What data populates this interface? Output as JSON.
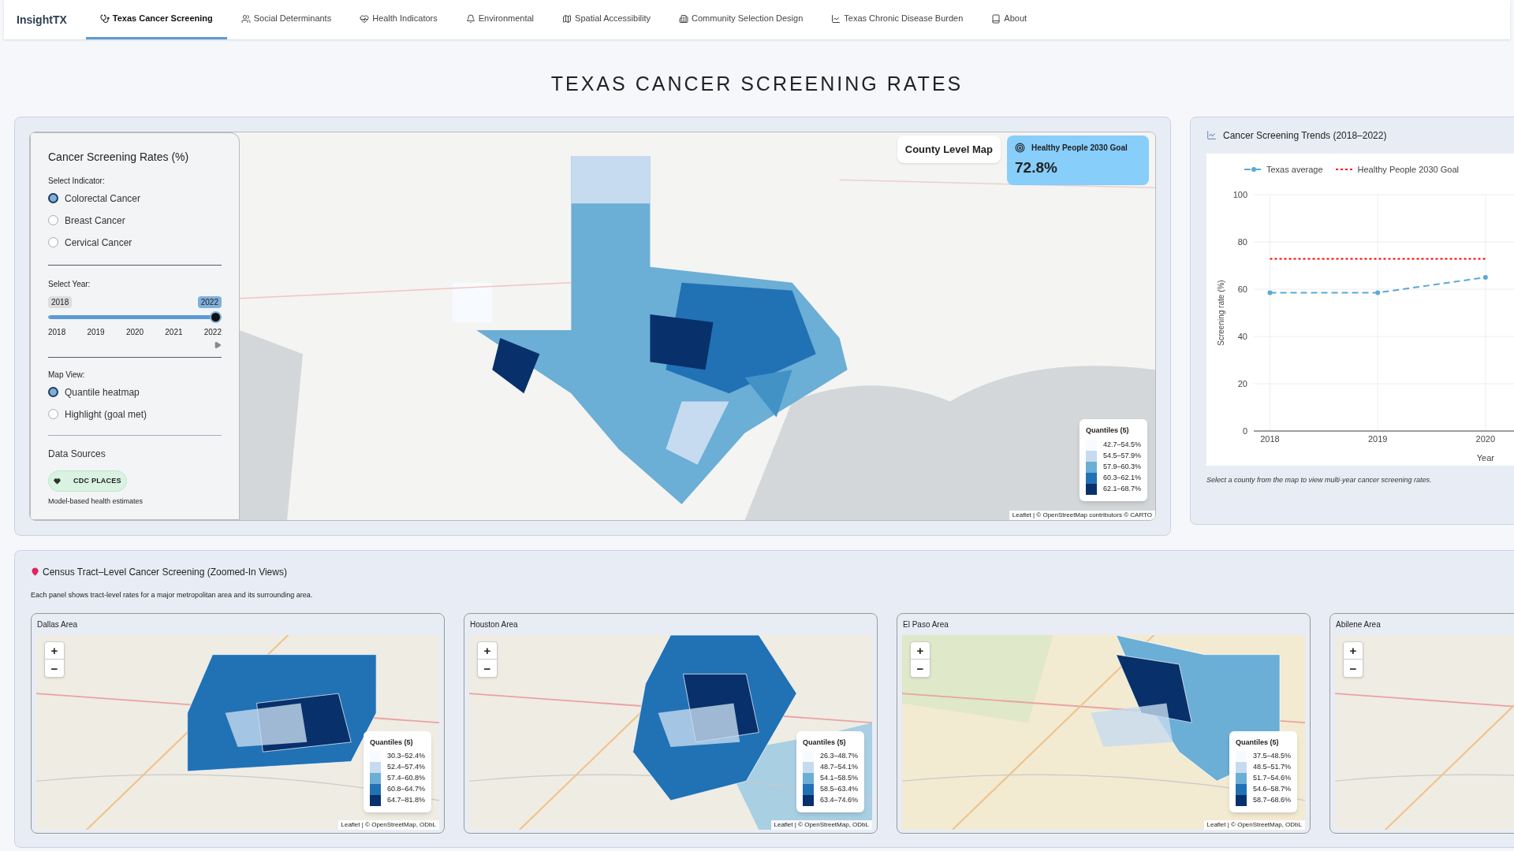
{
  "nav": {
    "brand": "InsightTX",
    "tabs": [
      {
        "label": "Texas Cancer Screening",
        "selected": true
      },
      {
        "label": "Social Determinants",
        "selected": false
      },
      {
        "label": "Health Indicators",
        "selected": false
      },
      {
        "label": "Environmental",
        "selected": false
      },
      {
        "label": "Spatial Accessibility",
        "selected": false
      },
      {
        "label": "Community Selection Design",
        "selected": false
      },
      {
        "label": "Texas Chronic Disease Burden",
        "selected": false
      },
      {
        "label": "About",
        "selected": false
      }
    ]
  },
  "page_title": "TEXAS CANCER SCREENING RATES",
  "controls": {
    "title": "Cancer Screening Rates (%)",
    "indicator_label": "Select Indicator:",
    "indicators": [
      {
        "label": "Colorectal Cancer",
        "selected": true
      },
      {
        "label": "Breast Cancer",
        "selected": false
      },
      {
        "label": "Cervical Cancer",
        "selected": false
      }
    ],
    "year_label": "Select Year:",
    "year_slider": {
      "min_label": "2018",
      "value_label": "2022",
      "level": 1,
      "ticks": [
        "2018",
        "2019",
        "2020",
        "2021",
        "2022"
      ]
    },
    "view_label": "Map View:",
    "views": [
      {
        "label": "Quantile heatmap",
        "selected": true
      },
      {
        "label": "Highlight (goal met)",
        "selected": false
      }
    ],
    "sources_title": "Data Sources",
    "source_badge": "CDC PLACES",
    "source_note": "Model-based health estimates"
  },
  "county_map": {
    "label": "County Level Map",
    "goal": {
      "title": "Healthy People 2030 Goal",
      "value": "72.8%"
    },
    "legend": {
      "title": "Quantiles (5)",
      "items": [
        {
          "label": "42.7–54.5%",
          "color": "#f7fbff"
        },
        {
          "label": "54.5–57.9%",
          "color": "#c6dbef"
        },
        {
          "label": "57.9–60.3%",
          "color": "#6baed6"
        },
        {
          "label": "60.3–62.1%",
          "color": "#2171b5"
        },
        {
          "label": "62.1–68.7%",
          "color": "#08306b"
        }
      ]
    },
    "attribution": "Leaflet | © OpenStreetMap contributors © CARTO"
  },
  "trends": {
    "title": "Cancer Screening Trends (2018–2022)",
    "note": "Select a county from the map to view multi-year cancer screening rates.",
    "chart_data": {
      "type": "line",
      "grid": true,
      "legend": "top",
      "xlim": [
        2017.85,
        2020.85
      ],
      "xlabel": "Year",
      "ylabel": "Screening rate (%)",
      "x": [
        2018,
        2019,
        2020
      ],
      "ylim": [
        0,
        100
      ],
      "yticks": [
        0,
        20,
        40,
        60,
        80,
        100
      ],
      "xticks": [
        2018,
        2019,
        2020
      ],
      "series": [
        {
          "name": "Texas average",
          "color": "#5aa9d6",
          "line_style": "dashed",
          "marker": "circle",
          "values": [
            58.5,
            58.5,
            65
          ]
        },
        {
          "name": "Healthy People 2030 Goal",
          "color": "#ff0000",
          "line_style": "dotted",
          "marker": "none",
          "values": [
            72.8,
            72.8,
            72.8
          ]
        }
      ]
    }
  },
  "tract_section": {
    "title": "Census Tract–Level Cancer Screening (Zoomed-In Views)",
    "note": "Each panel shows tract-level rates for a major metropolitan area and its surrounding area.",
    "panels": [
      {
        "title": "Dallas Area",
        "zoom_in": "+",
        "zoom_out": "−",
        "legend": {
          "title": "Quantiles (5)",
          "items": [
            {
              "label": "30.3–52.4%",
              "color": "#f7fbff"
            },
            {
              "label": "52.4–57.4%",
              "color": "#c6dbef"
            },
            {
              "label": "57.4–60.8%",
              "color": "#6baed6"
            },
            {
              "label": "60.8–64.7%",
              "color": "#2171b5"
            },
            {
              "label": "64.7–81.8%",
              "color": "#08306b"
            }
          ]
        },
        "attribution": "Leaflet | © OpenStreetMap, ODbL"
      },
      {
        "title": "Houston Area",
        "zoom_in": "+",
        "zoom_out": "−",
        "legend": {
          "title": "Quantiles (5)",
          "items": [
            {
              "label": "26.3–48.7%",
              "color": "#f7fbff"
            },
            {
              "label": "48.7–54.1%",
              "color": "#c6dbef"
            },
            {
              "label": "54.1–58.5%",
              "color": "#6baed6"
            },
            {
              "label": "58.5–63.4%",
              "color": "#2171b5"
            },
            {
              "label": "63.4–74.6%",
              "color": "#08306b"
            }
          ]
        },
        "attribution": "Leaflet | © OpenStreetMap, ODbL"
      },
      {
        "title": "El Paso Area",
        "zoom_in": "+",
        "zoom_out": "−",
        "legend": {
          "title": "Quantiles (5)",
          "items": [
            {
              "label": "37.5–48.5%",
              "color": "#f7fbff"
            },
            {
              "label": "48.5–51.7%",
              "color": "#c6dbef"
            },
            {
              "label": "51.7–54.6%",
              "color": "#6baed6"
            },
            {
              "label": "54.6–58.7%",
              "color": "#2171b5"
            },
            {
              "label": "58.7–68.6%",
              "color": "#08306b"
            }
          ]
        },
        "attribution": "Leaflet | © OpenStreetMap, ODbL"
      },
      {
        "title": "Abilene Area",
        "zoom_in": "+",
        "zoom_out": "−"
      }
    ]
  }
}
